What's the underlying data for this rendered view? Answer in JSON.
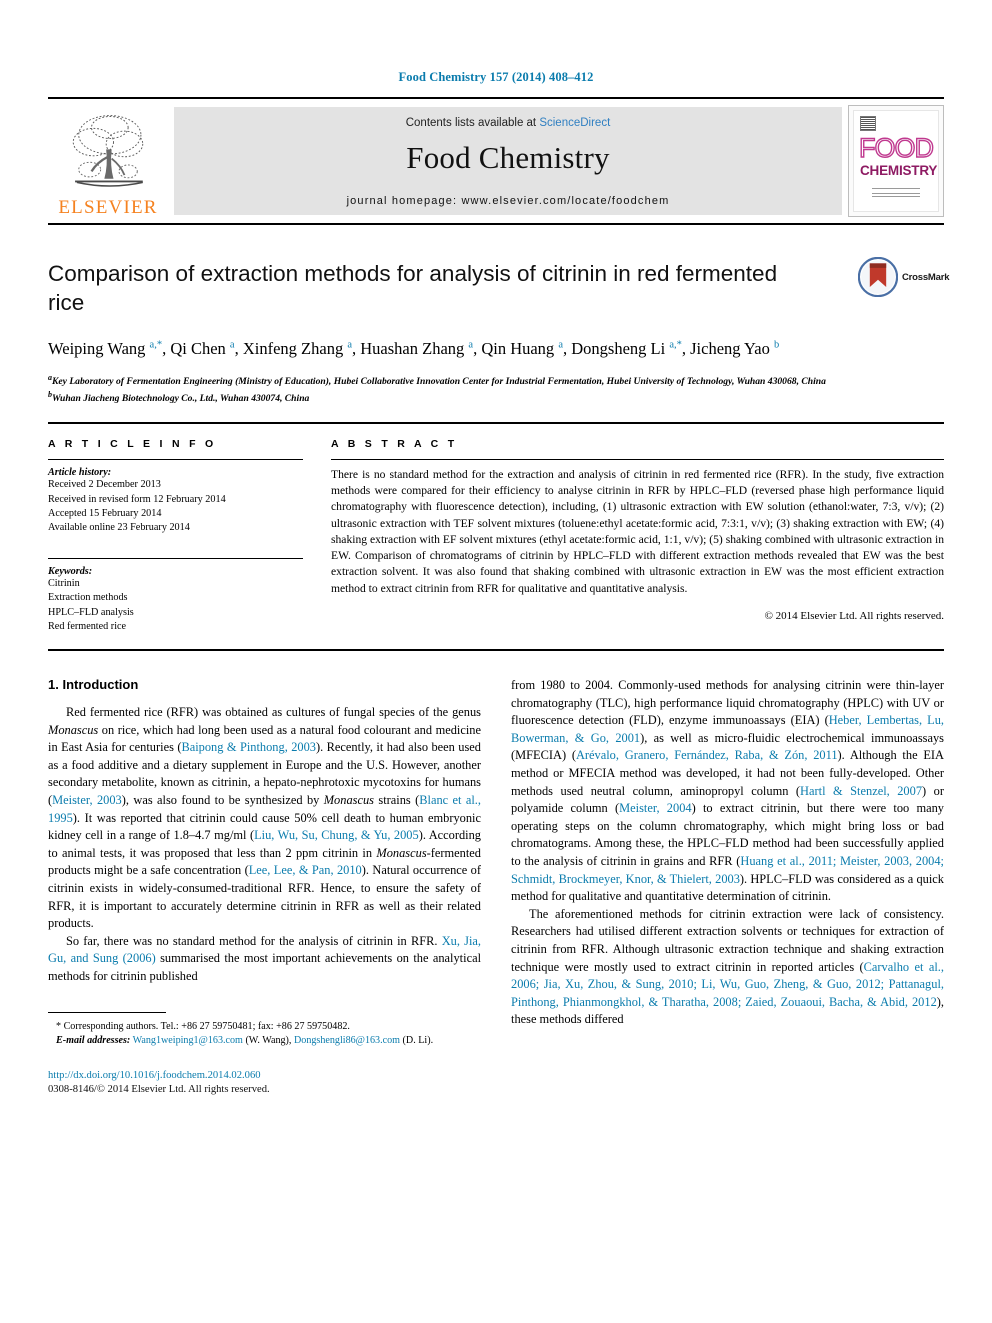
{
  "running_head": "Food Chemistry 157 (2014) 408–412",
  "masthead": {
    "contents_prefix": "Contents lists available at ",
    "sciencedirect": "ScienceDirect",
    "journal_title": "Food Chemistry",
    "homepage": "journal homepage: www.elsevier.com/locate/foodchem",
    "publisher_wordmark": "ELSEVIER",
    "cover": {
      "line1": "FOOD",
      "line2": "CHEMISTRY"
    },
    "colors": {
      "sciencedirect_blue": "#2f7fc1",
      "elsevier_orange": "#F58220",
      "band_grey": "#e3e3e3"
    }
  },
  "article": {
    "title": "Comparison of extraction methods for analysis of citrinin in red fermented rice",
    "crossmark_label": "CrossMark",
    "authors_html": "Weiping Wang <sup>a,</sup><sup>*</sup>, Qi Chen <sup>a</sup>, Xinfeng Zhang <sup>a</sup>, Huashan Zhang <sup>a</sup>, Qin Huang <sup>a</sup>, Dongsheng Li <sup>a,</sup><sup>*</sup>, Jicheng Yao <sup>b</sup>",
    "affiliations": [
      "a Key Laboratory of Fermentation Engineering (Ministry of Education), Hubei Collaborative Innovation Center for Industrial Fermentation, Hubei University of Technology, Wuhan 430068, China",
      "b Wuhan Jiacheng Biotechnology Co., Ltd., Wuhan 430074, China"
    ]
  },
  "article_info": {
    "heading": "A R T I C L E   I N F O",
    "history_label": "Article history:",
    "history": [
      "Received 2 December 2013",
      "Received in revised form 12 February 2014",
      "Accepted 15 February 2014",
      "Available online 23 February 2014"
    ],
    "keywords_label": "Keywords:",
    "keywords": [
      "Citrinin",
      "Extraction methods",
      "HPLC–FLD analysis",
      "Red fermented rice"
    ]
  },
  "abstract": {
    "heading": "A B S T R A C T",
    "text": "There is no standard method for the extraction and analysis of citrinin in red fermented rice (RFR). In the study, five extraction methods were compared for their efficiency to analyse citrinin in RFR by HPLC–FLD (reversed phase high performance liquid chromatography with fluorescence detection), including, (1) ultrasonic extraction with EW solution (ethanol:water, 7:3, v/v); (2) ultrasonic extraction with TEF solvent mixtures (toluene:ethyl acetate:formic acid, 7:3:1, v/v); (3) shaking extraction with EW; (4) shaking extraction with EF solvent mixtures (ethyl acetate:formic acid, 1:1, v/v); (5) shaking combined with ultrasonic extraction in EW. Comparison of chromatograms of citrinin by HPLC–FLD with different extraction methods revealed that EW was the best extraction solvent. It was also found that shaking combined with ultrasonic extraction in EW was the most efficient extraction method to extract citrinin from RFR for qualitative and quantitative analysis.",
    "copyright": "© 2014 Elsevier Ltd. All rights reserved."
  },
  "introduction": {
    "heading": "1. Introduction",
    "left_paragraphs": [
      "Red fermented rice (RFR) was obtained as cultures of fungal species of the genus <i>Monascus</i> on rice, which had long been used as a natural food colourant and medicine in East Asia for centuries (<span class=\"cite\">Baipong &amp; Pinthong, 2003</span>). Recently, it had also been used as a food additive and a dietary supplement in Europe and the U.S. However, another secondary metabolite, known as citrinin, a hepato-nephrotoxic mycotoxins for humans (<span class=\"cite\">Meister, 2003</span>), was also found to be synthesized by <i>Monascus</i> strains (<span class=\"cite\">Blanc et al., 1995</span>). It was reported that citrinin could cause 50% cell death to human embryonic kidney cell in a range of 1.8–4.7 mg/ml (<span class=\"cite\">Liu, Wu, Su, Chung, &amp; Yu, 2005</span>). According to animal tests, it was proposed that less than 2 ppm citrinin in <i>Monascus</i>-fermented products might be a safe concentration (<span class=\"cite\">Lee, Lee, &amp; Pan, 2010</span>). Natural occurrence of citrinin exists in widely-consumed-traditional RFR. Hence, to ensure the safety of RFR, it is important to accurately determine citrinin in RFR as well as their related products.",
      "So far, there was no standard method for the analysis of citrinin in RFR. <span class=\"cite\">Xu, Jia, Gu, and Sung (2006)</span> summarised the most important achievements on the analytical methods for citrinin published"
    ],
    "right_paragraphs": [
      "from 1980 to 2004. Commonly-used methods for analysing citrinin were thin-layer chromatography (TLC), high performance liquid chromatography (HPLC) with UV or fluorescence detection (FLD), enzyme immunoassays (EIA) (<span class=\"cite\">Heber, Lembertas, Lu, Bowerman, &amp; Go, 2001</span>), as well as micro-fluidic electrochemical immunoassays (MFECIA) (<span class=\"cite\">Arévalo, Granero, Fernández, Raba, &amp; Zón, 2011</span>). Although the EIA method or MFECIA method was developed, it had not been fully-developed. Other methods used neutral column, aminopropyl column (<span class=\"cite\">Hartl &amp; Stenzel, 2007</span>) or polyamide column (<span class=\"cite\">Meister, 2004</span>) to extract citrinin, but there were too many operating steps on the column chromatography, which might bring loss or bad chromatograms. Among these, the HPLC–FLD method had been successfully applied to the analysis of citrinin in grains and RFR (<span class=\"cite\">Huang et al., 2011; Meister, 2003, 2004; Schmidt, Brockmeyer, Knor, &amp; Thielert, 2003</span>). HPLC–FLD was considered as a quick method for qualitative and quantitative determination of citrinin.",
      "The aforementioned methods for citrinin extraction were lack of consistency. Researchers had utilised different extraction solvents or techniques for extraction of citrinin from RFR. Although ultrasonic extraction technique and shaking extraction technique were mostly used to extract citrinin in reported articles (<span class=\"cite\">Carvalho et al., 2006; Jia, Xu, Zhou, &amp; Sung, 2010; Li, Wu, Guo, Zheng, &amp; Guo, 2012; Pattanagul, Pinthong, Phianmongkhol, &amp; Tharatha, 2008; Zaied, Zouaoui, Bacha, &amp; Abid, 2012</span>), these methods differed"
    ]
  },
  "footnotes": {
    "corresponding": "* Corresponding authors. Tel.: +86 27 59750481; fax: +86 27 59750482.",
    "email_label": "E-mail addresses:",
    "email_1": "Wang1weiping1@163.com",
    "email_1_owner": "(W. Wang),",
    "email_2": "Dongshengli86@163.com",
    "email_2_owner": "(D. Li).",
    "doi": "http://dx.doi.org/10.1016/j.foodchem.2014.02.060",
    "issn_line": "0308-8146/© 2014 Elsevier Ltd. All rights reserved."
  }
}
